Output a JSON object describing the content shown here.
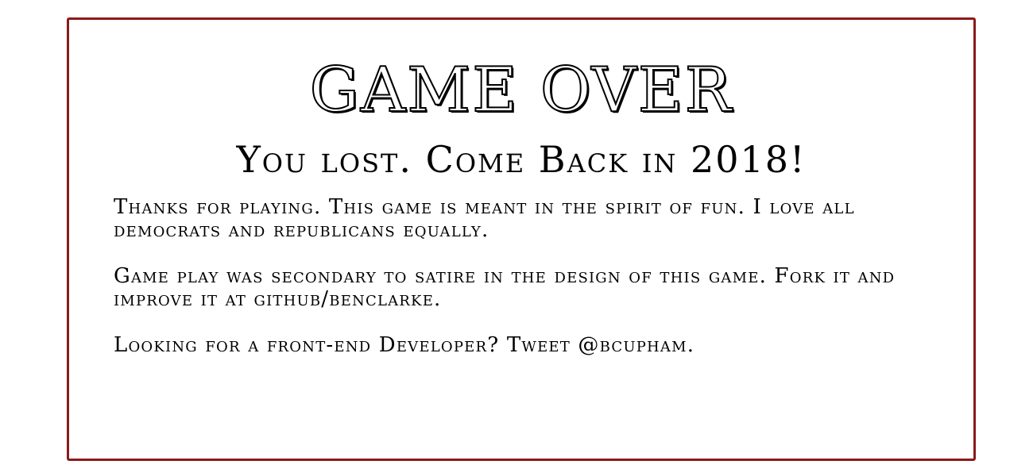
{
  "game_over": {
    "title": "GAME OVER",
    "subtitle": "You lost. Come Back in 2018!",
    "paragraphs": [
      "Thanks for playing. This game is meant in the spirit of fun. I love all democrats and republicans equally.",
      "Game play was secondary to satire in the design of this game. Fork it and improve it at github/benclarke.",
      "Looking for a front-end Developer? Tweet @bcupham."
    ]
  },
  "colors": {
    "frame_border": "#8b1a1a",
    "text": "#000000",
    "background": "#ffffff"
  }
}
